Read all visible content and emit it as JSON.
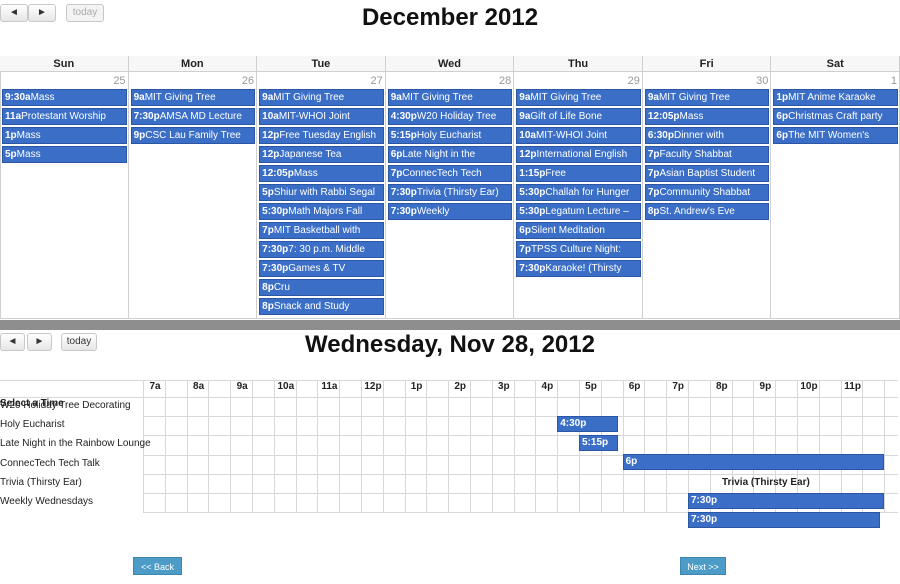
{
  "month_view": {
    "prev_label": "◄",
    "next_label": "►",
    "today_label": "today",
    "title": "December 2012",
    "weekdays": [
      "Sun",
      "Mon",
      "Tue",
      "Wed",
      "Thu",
      "Fri",
      "Sat"
    ],
    "day_numbers": [
      "25",
      "26",
      "27",
      "28",
      "29",
      "30",
      "1"
    ],
    "days": [
      [
        {
          "time": "9:30a",
          "title": "Mass"
        },
        {
          "time": "11a",
          "title": "Protestant Worship"
        },
        {
          "time": "1p",
          "title": "Mass"
        },
        {
          "time": "5p",
          "title": "Mass"
        }
      ],
      [
        {
          "time": "9a",
          "title": "MIT Giving Tree"
        },
        {
          "time": "7:30p",
          "title": "AMSA MD Lecture"
        },
        {
          "time": "9p",
          "title": "CSC Lau Family Tree"
        }
      ],
      [
        {
          "time": "9a",
          "title": "MIT Giving Tree"
        },
        {
          "time": "10a",
          "title": "MIT-WHOI Joint"
        },
        {
          "time": "12p",
          "title": "Free Tuesday English"
        },
        {
          "time": "12p",
          "title": "Japanese Tea"
        },
        {
          "time": "12:05p",
          "title": "Mass"
        },
        {
          "time": "5p",
          "title": "Shiur with Rabbi Segal"
        },
        {
          "time": "5:30p",
          "title": "Math Majors Fall"
        },
        {
          "time": "7p",
          "title": "MIT Basketball with"
        },
        {
          "time": "7:30p",
          "title": "7: 30 p.m. Middle"
        },
        {
          "time": "7:30p",
          "title": "Games & TV"
        },
        {
          "time": "8p",
          "title": "Cru"
        },
        {
          "time": "8p",
          "title": "Snack and Study"
        }
      ],
      [
        {
          "time": "9a",
          "title": "MIT Giving Tree"
        },
        {
          "time": "4:30p",
          "title": "W20 Holiday Tree"
        },
        {
          "time": "5:15p",
          "title": "Holy Eucharist"
        },
        {
          "time": "6p",
          "title": "Late Night in the"
        },
        {
          "time": "7p",
          "title": "ConnecTech Tech"
        },
        {
          "time": "7:30p",
          "title": "Trivia (Thirsty Ear)"
        },
        {
          "time": "7:30p",
          "title": "Weekly"
        }
      ],
      [
        {
          "time": "9a",
          "title": "MIT Giving Tree"
        },
        {
          "time": "9a",
          "title": "Gift of Life Bone"
        },
        {
          "time": "10a",
          "title": "MIT-WHOI Joint"
        },
        {
          "time": "12p",
          "title": "International English"
        },
        {
          "time": "1:15p",
          "title": "Free"
        },
        {
          "time": "5:30p",
          "title": "Challah for Hunger"
        },
        {
          "time": "5:30p",
          "title": "Legatum Lecture –"
        },
        {
          "time": "6p",
          "title": "Silent Meditation"
        },
        {
          "time": "7p",
          "title": "TPSS Culture Night:"
        },
        {
          "time": "7:30p",
          "title": "Karaoke! (Thirsty"
        }
      ],
      [
        {
          "time": "9a",
          "title": "MIT Giving Tree"
        },
        {
          "time": "12:05p",
          "title": "Mass"
        },
        {
          "time": "6:30p",
          "title": "Dinner with"
        },
        {
          "time": "7p",
          "title": "Faculty Shabbat"
        },
        {
          "time": "7p",
          "title": "Asian Baptist Student"
        },
        {
          "time": "7p",
          "title": "Community Shabbat"
        },
        {
          "time": "8p",
          "title": "St. Andrew's Eve"
        }
      ],
      [
        {
          "time": "1p",
          "title": "MIT Anime Karaoke"
        },
        {
          "time": "6p",
          "title": "Christmas Craft party"
        },
        {
          "time": "6p",
          "title": "The MIT Women's"
        }
      ]
    ]
  },
  "day_view": {
    "prev_label": "◄",
    "next_label": "►",
    "today_label": "today",
    "title": "Wednesday, Nov 28, 2012",
    "select_label": "Select a Time",
    "hours": [
      "7a",
      "8a",
      "9a",
      "10a",
      "11a",
      "12p",
      "1p",
      "2p",
      "3p",
      "4p",
      "5p",
      "6p",
      "7p",
      "8p",
      "9p",
      "10p",
      "11p"
    ],
    "rows": [
      {
        "label": "W20 Holiday Tree Decorating",
        "bar": {
          "text": "4:30p",
          "start_hour": 16.5,
          "end_hour": 17.9
        }
      },
      {
        "label": "Holy Eucharist",
        "bar": {
          "text": "5:15p",
          "start_hour": 17.0,
          "end_hour": 17.9
        }
      },
      {
        "label": "Late Night in the Rainbow Lounge",
        "bar": {
          "text": "6p",
          "start_hour": 18.0,
          "end_hour": 24.0
        }
      },
      {
        "label": "ConnecTech Tech Talk",
        "bar": null,
        "floating_text": "Trivia (Thirsty Ear)"
      },
      {
        "label": "Trivia (Thirsty Ear)",
        "bar": {
          "text": "7:30p",
          "start_hour": 19.5,
          "end_hour": 24.0
        }
      },
      {
        "label": "Weekly Wednesdays",
        "bar": {
          "text": "7:30p",
          "start_hour": 19.5,
          "end_hour": 23.9
        }
      }
    ]
  },
  "footer": {
    "back_label": "<< Back",
    "next_label": "Next >>"
  }
}
